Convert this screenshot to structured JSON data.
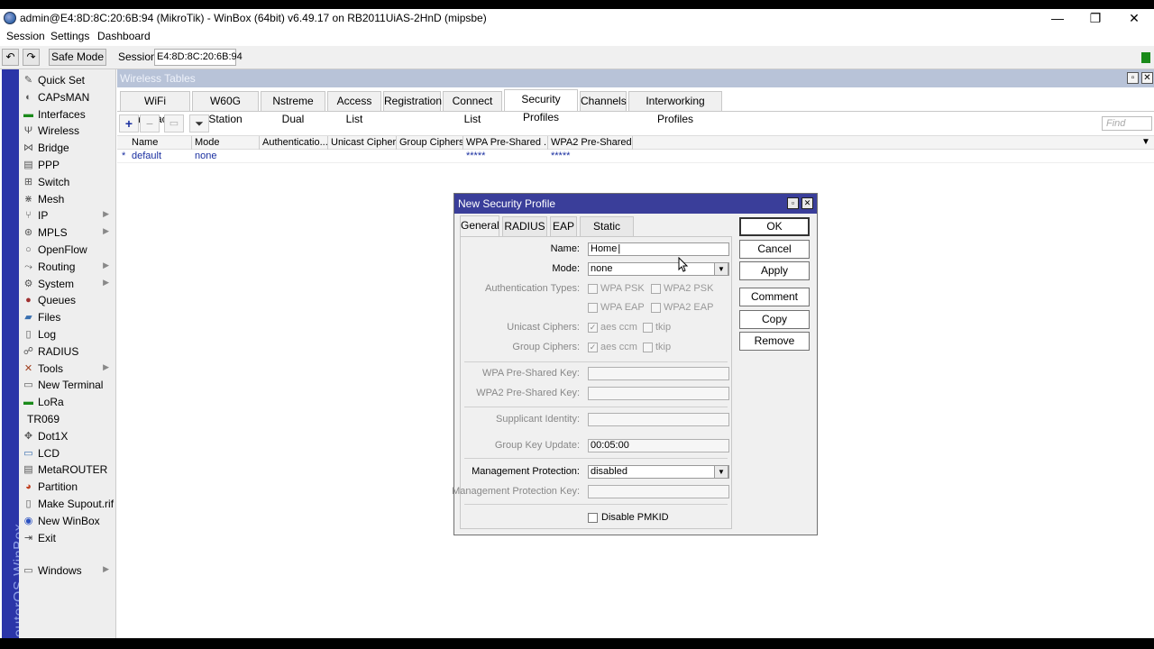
{
  "window": {
    "title": "admin@E4:8D:8C:20:6B:94 (MikroTik) - WinBox (64bit) v6.49.17 on RB2011UiAS-2HnD (mipsbe)",
    "minimize": "—",
    "restore": "❐",
    "close": "✕"
  },
  "menubar": {
    "session": "Session",
    "settings": "Settings",
    "dashboard": "Dashboard"
  },
  "toolbar": {
    "undo": "↶",
    "redo": "↷",
    "safe_mode": "Safe Mode",
    "session_label": "Session:",
    "session_value": "E4:8D:8C:20:6B:94"
  },
  "brand": "RouterOS WinBox",
  "sidebar": {
    "items": [
      {
        "label": "Quick Set",
        "icon": "wand-icon",
        "submenu": false
      },
      {
        "label": "CAPsMAN",
        "icon": "capsman-icon",
        "submenu": false
      },
      {
        "label": "Interfaces",
        "icon": "interfaces-icon",
        "submenu": false
      },
      {
        "label": "Wireless",
        "icon": "antenna-icon",
        "submenu": false
      },
      {
        "label": "Bridge",
        "icon": "bridge-icon",
        "submenu": false
      },
      {
        "label": "PPP",
        "icon": "ppp-icon",
        "submenu": false
      },
      {
        "label": "Switch",
        "icon": "switch-icon",
        "submenu": false
      },
      {
        "label": "Mesh",
        "icon": "mesh-icon",
        "submenu": false
      },
      {
        "label": "IP",
        "icon": "ip-icon",
        "submenu": true
      },
      {
        "label": "MPLS",
        "icon": "mpls-icon",
        "submenu": true
      },
      {
        "label": "OpenFlow",
        "icon": "openflow-icon",
        "submenu": false
      },
      {
        "label": "Routing",
        "icon": "routing-icon",
        "submenu": true
      },
      {
        "label": "System",
        "icon": "system-icon",
        "submenu": true
      },
      {
        "label": "Queues",
        "icon": "queues-icon",
        "submenu": false
      },
      {
        "label": "Files",
        "icon": "folder-icon",
        "submenu": false
      },
      {
        "label": "Log",
        "icon": "log-icon",
        "submenu": false
      },
      {
        "label": "RADIUS",
        "icon": "radius-icon",
        "submenu": false
      },
      {
        "label": "Tools",
        "icon": "tools-icon",
        "submenu": true
      },
      {
        "label": "New Terminal",
        "icon": "terminal-icon",
        "submenu": false
      },
      {
        "label": "LoRa",
        "icon": "lora-icon",
        "submenu": false
      },
      {
        "label": "TR069",
        "icon": "",
        "submenu": false
      },
      {
        "label": "Dot1X",
        "icon": "dot1x-icon",
        "submenu": false
      },
      {
        "label": "LCD",
        "icon": "lcd-icon",
        "submenu": false
      },
      {
        "label": "MetaROUTER",
        "icon": "metarouter-icon",
        "submenu": false
      },
      {
        "label": "Partition",
        "icon": "partition-icon",
        "submenu": false
      },
      {
        "label": "Make Supout.rif",
        "icon": "supout-icon",
        "submenu": false
      },
      {
        "label": "New WinBox",
        "icon": "winbox-icon",
        "submenu": false
      },
      {
        "label": "Exit",
        "icon": "exit-icon",
        "submenu": false
      },
      {
        "label": "Windows",
        "icon": "windows-icon",
        "submenu": true
      }
    ]
  },
  "main": {
    "title": "Wireless Tables",
    "tabs": [
      {
        "label": "WiFi Interfaces"
      },
      {
        "label": "W60G Station"
      },
      {
        "label": "Nstreme Dual"
      },
      {
        "label": "Access List"
      },
      {
        "label": "Registration"
      },
      {
        "label": "Connect List"
      },
      {
        "label": "Security Profiles",
        "active": true
      },
      {
        "label": "Channels"
      },
      {
        "label": "Interworking Profiles"
      }
    ],
    "find_placeholder": "Find",
    "columns": [
      "Name",
      "Mode",
      "Authenticatio...",
      "Unicast Ciphers",
      "Group Ciphers",
      "WPA Pre-Shared ...",
      "WPA2 Pre-Shared..."
    ],
    "rows": [
      {
        "marker": "*",
        "name": "default",
        "mode": "none",
        "wpa": "*****",
        "wpa2": "*****"
      }
    ]
  },
  "dialog": {
    "title": "New Security Profile",
    "tabs": [
      "General",
      "RADIUS",
      "EAP",
      "Static Keys"
    ],
    "name_label": "Name:",
    "name_value": "Home",
    "mode_label": "Mode:",
    "mode_value": "none",
    "auth_types_label": "Authentication Types:",
    "auth_types": {
      "wpa_psk": "WPA PSK",
      "wpa2_psk": "WPA2 PSK",
      "wpa_eap": "WPA EAP",
      "wpa2_eap": "WPA2 EAP"
    },
    "unicast_label": "Unicast Ciphers:",
    "group_label": "Group Ciphers:",
    "cipher_aes": "aes ccm",
    "cipher_tkip": "tkip",
    "wpa_psk_label": "WPA Pre-Shared Key:",
    "wpa2_psk_label": "WPA2 Pre-Shared Key:",
    "supplicant_label": "Supplicant Identity:",
    "group_key_label": "Group Key Update:",
    "group_key_value": "00:05:00",
    "mgmt_protection_label": "Management Protection:",
    "mgmt_protection_value": "disabled",
    "mgmt_key_label": "Management Protection Key:",
    "disable_pmkid_label": "Disable PMKID",
    "buttons": {
      "ok": "OK",
      "cancel": "Cancel",
      "apply": "Apply",
      "comment": "Comment",
      "copy": "Copy",
      "remove": "Remove"
    }
  },
  "colors": {
    "brand_bar": "#2b35a8",
    "dialog_title": "#3a3e9a",
    "status_led": "#1a8a1a"
  }
}
